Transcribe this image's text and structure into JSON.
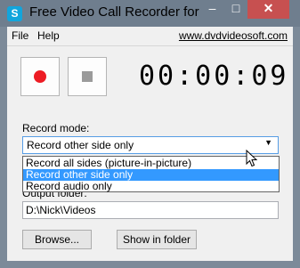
{
  "window": {
    "title": "Free Video Call Recorder for ...",
    "icon": "skype-icon",
    "controls": {
      "minimize": "–",
      "maximize": "□",
      "close": "✕"
    }
  },
  "menu": {
    "file": "File",
    "help": "Help",
    "site": "www.dvdvideosoft.com"
  },
  "recorder": {
    "record_icon": "record-icon",
    "stop_icon": "stop-icon",
    "timer": "00:00:09"
  },
  "record_mode": {
    "label": "Record mode:",
    "selected": "Record other side only",
    "options": [
      "Record all sides (picture-in-picture)",
      "Record other side only",
      "Record audio only"
    ],
    "highlighted_index": 1
  },
  "output": {
    "label": "Output folder:",
    "path": "D:\\Nick\\Videos"
  },
  "buttons": {
    "browse": "Browse...",
    "show_in_folder": "Show in folder"
  },
  "colors": {
    "record": "#ed1c24",
    "selection": "#3399ff",
    "close": "#c75050"
  }
}
